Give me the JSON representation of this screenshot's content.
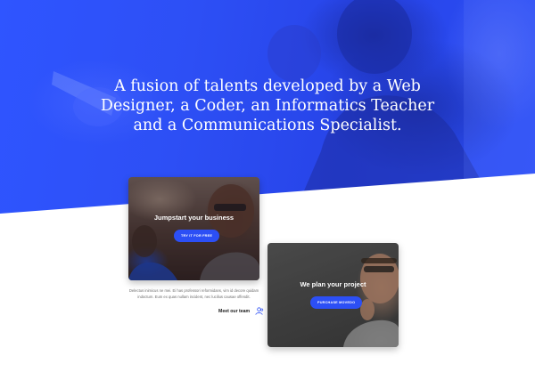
{
  "hero": {
    "title": "A fusion of talents developed by a Web Designer, a Coder, an Informatics Teacher and a Communications Specialist."
  },
  "cards": [
    {
      "title": "Jumpstart your business",
      "button_label": "TRY IT FOR FREE"
    },
    {
      "title": "We plan your project",
      "button_label": "PURCHASE MOVEDO"
    }
  ],
  "team": {
    "description": "Delectus inimicus ne mei. Ei has professori reformidans, vim id decore quidam indoctum. Eum ex quas nullam incident, nec lucilius causae offendit.",
    "link_label": "Meet our team",
    "icon": "team-icon"
  },
  "colors": {
    "accent": "#2c4ff5",
    "hero_blue": "#2d4ff5",
    "text_dark": "#1b1b1b",
    "text_muted": "#6d6d6d"
  }
}
